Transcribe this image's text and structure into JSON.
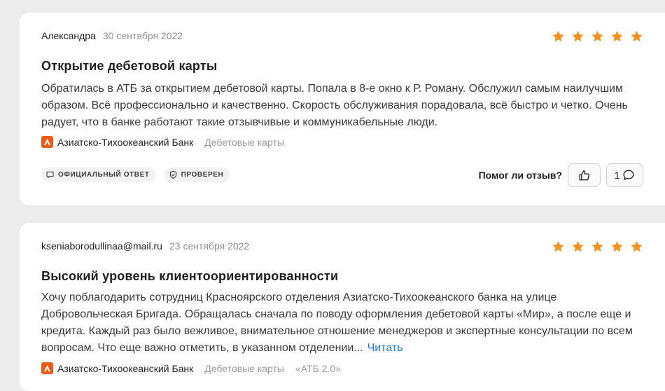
{
  "reviews": [
    {
      "author": "Александра",
      "date": "30 сентября 2022",
      "rating": 5,
      "title": "Открытие дебетовой карты",
      "body": "Обратилась в АТБ за открытием дебетовой карты. Попала в 8-е окно к Р. Роману. Обслужил самым наилучшим образом. Всё профессионально и качественно. Скорость обслуживания порадовала, всё быстро и четко. Очень радует, что в банке работают такие отзывчивые и коммуникабельные люди.",
      "bank": "Азиатско-Тихоокеанский Банк",
      "tags": [
        "Дебетовые карты"
      ],
      "badges": [
        "ОФИЦИАЛЬНЫЙ ОТВЕТ",
        "ПРОВЕРЕН"
      ],
      "helpful_label": "Помог ли отзыв?",
      "comment_count": "1"
    },
    {
      "author": "kseniaborodullinaa@mail.ru",
      "date": "23 сентября 2022",
      "rating": 5,
      "title": "Высокий уровень клиентоориентированности",
      "body": "Хочу поблагодарить сотрудниц Красноярского отделения Азиатско-Тихоокеанского банка на улице Добровольческая Бригада. Обращалась сначала по поводу оформления дебетовой карты «Мир», а после еще и кредита. Каждый раз было вежливое, внимательное отношение менеджеров и экспертные консультации по всем вопросам. Что еще важно отметить, в указанном отделении...",
      "read_more": "Читать",
      "bank": "Азиатско-Тихоокеанский Банк",
      "tags": [
        "Дебетовые карты",
        "«АТБ 2.0»"
      ]
    }
  ],
  "colors": {
    "star": "#f6911e",
    "brand": "#f25a14",
    "link": "#1c7be3"
  },
  "icons": {
    "star": "star-icon",
    "bank_logo": "atb-logo-icon",
    "official": "speech-bubble-icon",
    "verified": "shield-check-icon",
    "like": "thumbs-up-icon",
    "comment": "comment-icon"
  }
}
